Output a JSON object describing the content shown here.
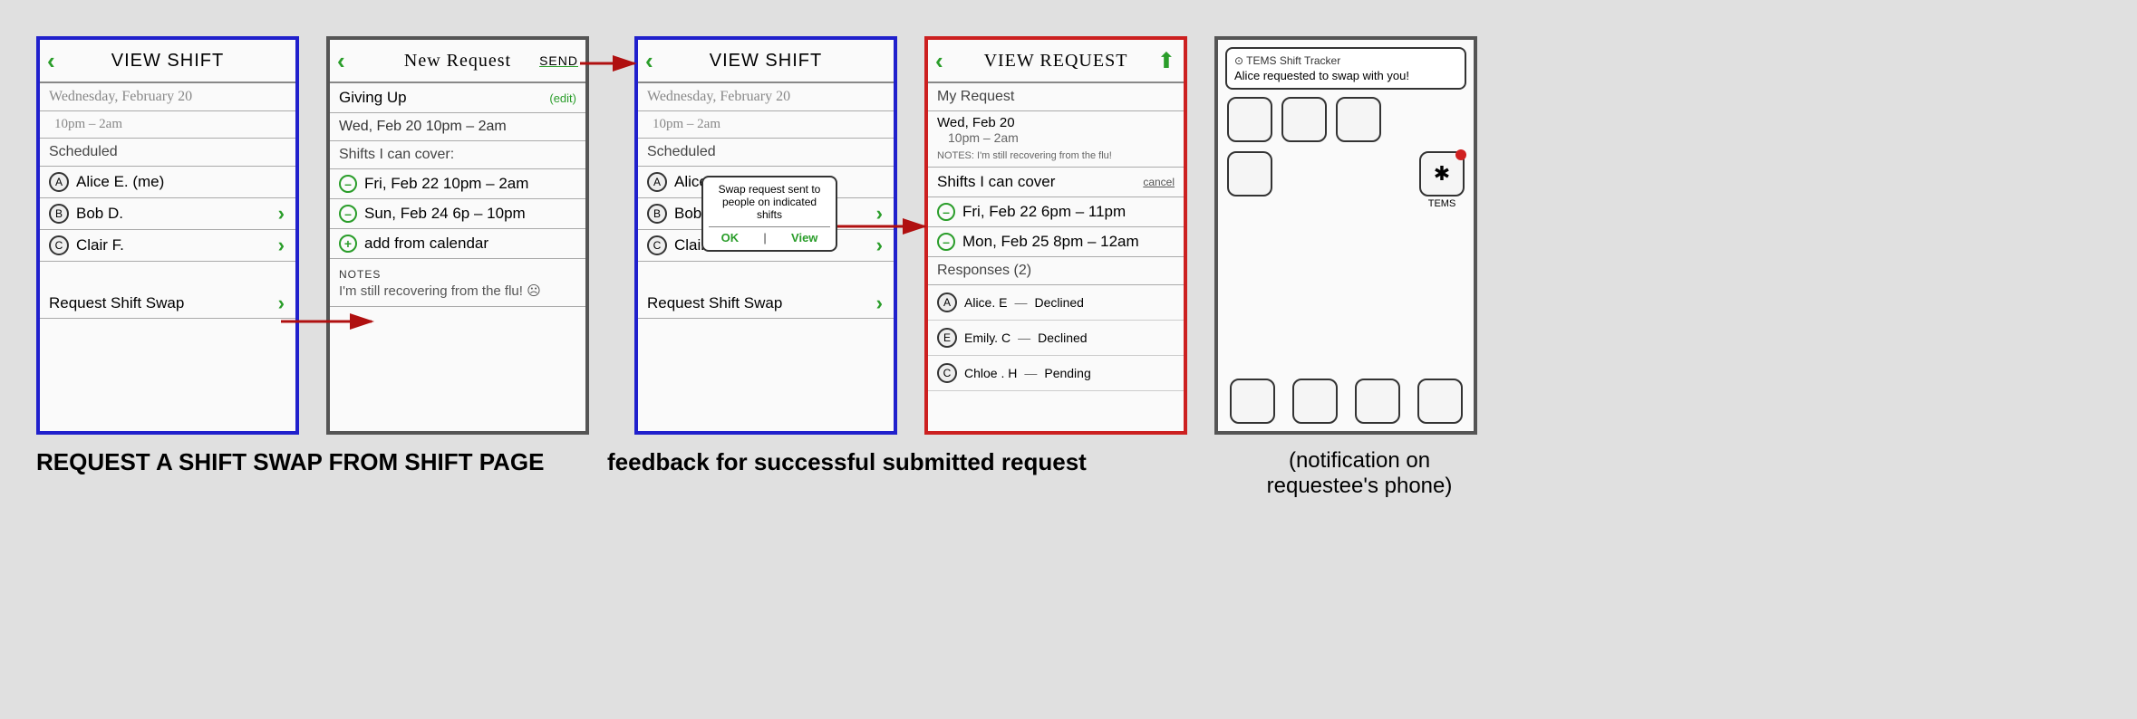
{
  "captions": {
    "left": "REQUEST A SHIFT SWAP FROM SHIFT PAGE",
    "mid": "feedback for successful submitted request",
    "right": "(notification on requestee's phone)"
  },
  "screen1": {
    "title": "VIEW SHIFT",
    "date": "Wednesday, February 20",
    "time": "10pm – 2am",
    "scheduled_label": "Scheduled",
    "people": [
      {
        "initial": "A",
        "name": "Alice E. (me)",
        "chev": false
      },
      {
        "initial": "B",
        "name": "Bob D.",
        "chev": true
      },
      {
        "initial": "C",
        "name": "Clair F.",
        "chev": true
      }
    ],
    "swap_button": "Request Shift Swap"
  },
  "screen2": {
    "title": "New Request",
    "send": "SEND",
    "giving_up_label": "Giving Up",
    "edit": "(edit)",
    "giving_up_shift": "Wed, Feb 20  10pm – 2am",
    "cover_label": "Shifts I can cover:",
    "cover_shifts": [
      "Fri, Feb 22  10pm – 2am",
      "Sun, Feb 24  6p – 10pm"
    ],
    "add_from_calendar": "add from calendar",
    "notes_label": "NOTES",
    "notes_text": "I'm still recovering from the flu! ☹"
  },
  "screen3": {
    "title": "VIEW SHIFT",
    "date": "Wednesday, February 20",
    "time": "10pm – 2am",
    "scheduled_label": "Scheduled",
    "people": [
      {
        "initial": "A",
        "name": "Alice",
        "chev": false
      },
      {
        "initial": "B",
        "name": "Bob",
        "chev": true
      },
      {
        "initial": "C",
        "name": "Clair F.",
        "chev": true
      }
    ],
    "swap_button": "Request Shift Swap",
    "popup": {
      "msg": "Swap request sent to people on indicated shifts",
      "ok": "OK",
      "view": "View"
    }
  },
  "screen4": {
    "title": "VIEW REQUEST",
    "my_request_label": "My Request",
    "shift_date": "Wed, Feb 20",
    "shift_time": "10pm – 2am",
    "notes_prefix": "NOTES:",
    "notes": "I'm still recovering from the flu!",
    "cover_label": "Shifts I can cover",
    "cancel": "cancel",
    "cover_shifts": [
      "Fri, Feb 22  6pm – 11pm",
      "Mon, Feb 25  8pm – 12am"
    ],
    "responses_label": "Responses (2)",
    "responses": [
      {
        "initial": "A",
        "name": "Alice. E",
        "status": "Declined"
      },
      {
        "initial": "E",
        "name": "Emily. C",
        "status": "Declined"
      },
      {
        "initial": "C",
        "name": "Chloe . H",
        "status": "Pending"
      }
    ]
  },
  "screen5": {
    "notif_app": "⊙ TEMS Shift Tracker",
    "notif_msg": "Alice requested to swap with you!",
    "tems_label": "TEMS",
    "tems_glyph": "✱"
  },
  "colors": {
    "accent": "#2a9d2a",
    "arrow": "#b01010"
  }
}
